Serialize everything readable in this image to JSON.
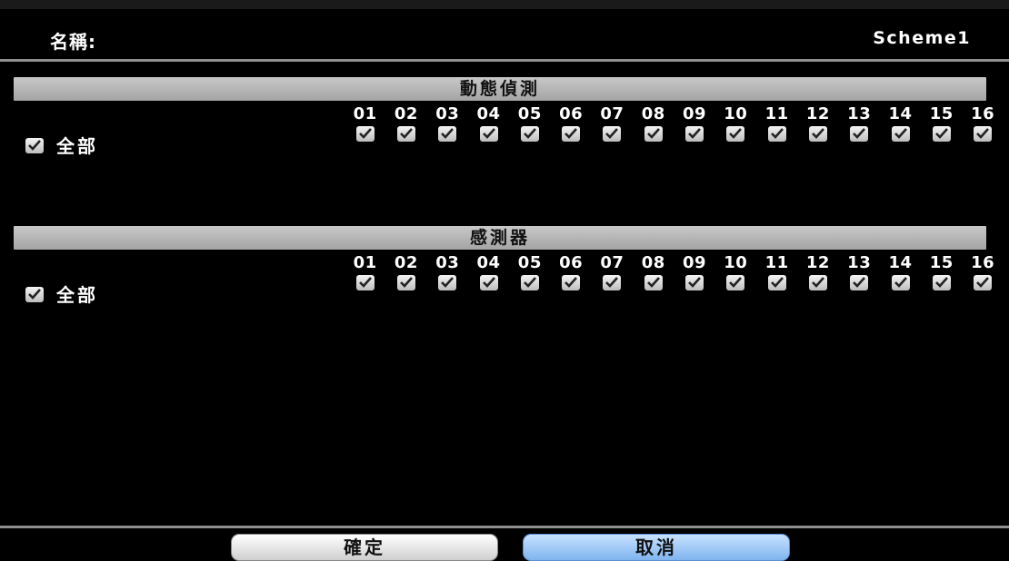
{
  "header": {
    "name_label": "名稱:",
    "name_value": "Scheme1"
  },
  "motion": {
    "title": "動態偵測",
    "all_label": "全部",
    "all_checked": true,
    "channels": [
      "01",
      "02",
      "03",
      "04",
      "05",
      "06",
      "07",
      "08",
      "09",
      "10",
      "11",
      "12",
      "13",
      "14",
      "15",
      "16"
    ],
    "checked": [
      true,
      true,
      true,
      true,
      true,
      true,
      true,
      true,
      true,
      true,
      true,
      true,
      true,
      true,
      true,
      true
    ]
  },
  "sensor": {
    "title": "感測器",
    "all_label": "全部",
    "all_checked": true,
    "channels": [
      "01",
      "02",
      "03",
      "04",
      "05",
      "06",
      "07",
      "08",
      "09",
      "10",
      "11",
      "12",
      "13",
      "14",
      "15",
      "16"
    ],
    "checked": [
      true,
      true,
      true,
      true,
      true,
      true,
      true,
      true,
      true,
      true,
      true,
      true,
      true,
      true,
      true,
      true
    ]
  },
  "footer": {
    "ok_label": "確定",
    "cancel_label": "取消"
  },
  "colors": {
    "background": "#000000",
    "section_bar": "#b4b4b4",
    "ok_button": "#e6e6e6",
    "cancel_button": "#9cc8f7"
  }
}
